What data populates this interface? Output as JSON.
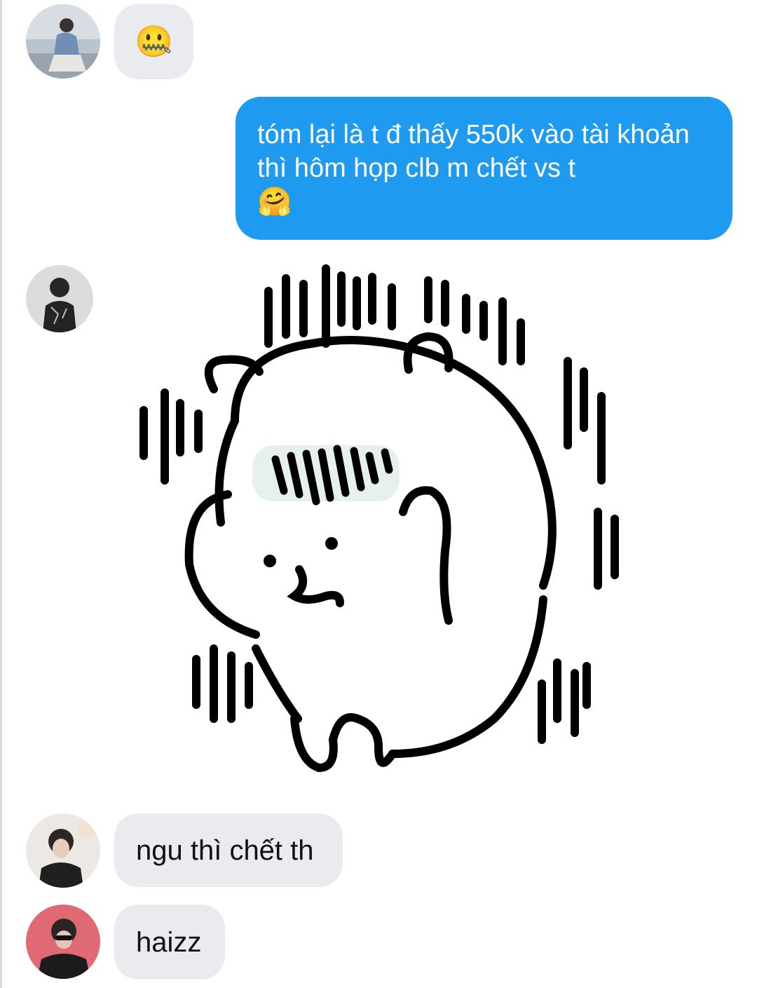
{
  "conversation": {
    "messages": [
      {
        "sender": "contact-1",
        "type": "emoji",
        "text": "🤐"
      },
      {
        "sender": "me",
        "type": "text",
        "text": "tóm lại là t đ thấy 550k vào tài khoản thì hôm họp clb m chết vs t",
        "emoji": "🤗"
      },
      {
        "sender": "contact-2",
        "type": "sticker",
        "sticker": "bear-covering-face-sticker"
      },
      {
        "sender": "contact-3",
        "type": "text",
        "text": "ngu thì chết th"
      },
      {
        "sender": "contact-4",
        "type": "text",
        "text": "haizz"
      }
    ]
  },
  "colors": {
    "outgoing_bubble": "#1e9bf0",
    "incoming_bubble": "#e9ebee",
    "outgoing_text": "#ffffff",
    "incoming_text": "#111111"
  }
}
